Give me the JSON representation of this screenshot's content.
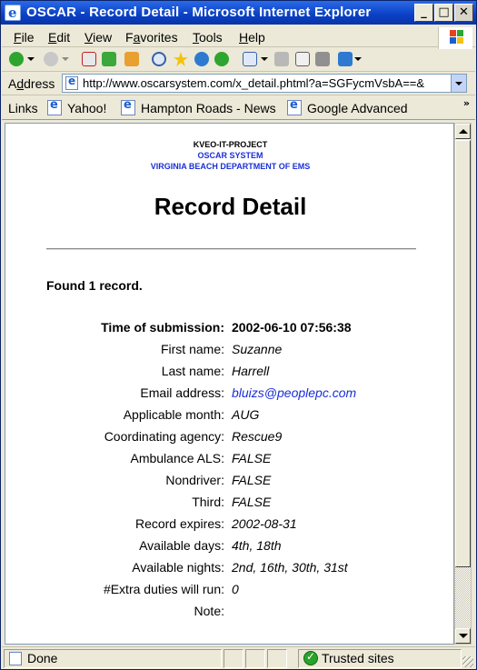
{
  "window": {
    "title": "OSCAR - Record Detail - Microsoft Internet Explorer",
    "minimize": "_",
    "maximize": "□",
    "close": "✕"
  },
  "menu": [
    {
      "hotkey": "F",
      "rest": "ile"
    },
    {
      "hotkey": "E",
      "rest": "dit"
    },
    {
      "hotkey": "V",
      "rest": "iew"
    },
    {
      "pre": "F",
      "hotkey": "a",
      "rest": "vorites"
    },
    {
      "hotkey": "T",
      "rest": "ools"
    },
    {
      "hotkey": "H",
      "rest": "elp"
    }
  ],
  "toolbar": {
    "icons": [
      "back-icon",
      "forward-icon",
      "stop-icon",
      "refresh-icon",
      "home-icon",
      "search-icon",
      "favorites-icon",
      "media-icon",
      "history-icon",
      "mail-icon",
      "print-icon",
      "edit-icon",
      "discuss-icon",
      "messenger-icon"
    ]
  },
  "address": {
    "label": "Address",
    "hotkey": "d",
    "url": "http://www.oscarsystem.com/x_detail.phtml?a=SGFycmVsbA==&"
  },
  "links": {
    "label": "Links",
    "items": [
      "Yahoo!",
      "Hampton Roads - News",
      "Google Advanced"
    ],
    "more": "»"
  },
  "page": {
    "org": "KVEO-IT-PROJECT",
    "system": "OSCAR SYSTEM",
    "dept": "VIRGINIA BEACH DEPARTMENT OF EMS",
    "title": "Record Detail",
    "found": "Found 1 record.",
    "fields": [
      {
        "label": "Time of submission:",
        "value": "2002-06-10 07:56:38"
      },
      {
        "label": "First name:",
        "value": "Suzanne"
      },
      {
        "label": "Last name:",
        "value": "Harrell"
      },
      {
        "label": "Email address:",
        "value": "bluizs@peoplepc.com"
      },
      {
        "label": "Applicable month:",
        "value": "AUG"
      },
      {
        "label": "Coordinating agency:",
        "value": "Rescue9"
      },
      {
        "label": "Ambulance ALS:",
        "value": "FALSE"
      },
      {
        "label": "Nondriver:",
        "value": "FALSE"
      },
      {
        "label": "Third:",
        "value": "FALSE"
      },
      {
        "label": "Record expires:",
        "value": "2002-08-31"
      },
      {
        "label": "Available days:",
        "value": "4th, 18th"
      },
      {
        "label": "Available nights:",
        "value": "2nd, 16th, 30th, 31st"
      },
      {
        "label": "#Extra duties will run:",
        "value": "0"
      },
      {
        "label": "Note:",
        "value": ""
      }
    ]
  },
  "status": {
    "text": "Done",
    "zone": "Trusted sites"
  },
  "colors": {
    "titlebar": "#0a3fc4",
    "link_blue": "#1a2fd8",
    "chrome": "#ece9d8"
  }
}
